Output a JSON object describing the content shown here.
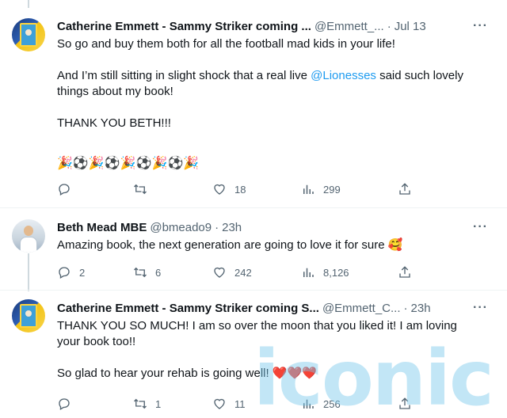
{
  "tweets": [
    {
      "name": "Catherine Emmett - Sammy Striker coming ...",
      "handle": "@Emmett_...",
      "sep": "·",
      "time": "Jul 13",
      "more": "···",
      "text_lines": [
        "So go and buy them both for all the football mad kids in your life!",
        "",
        "And I’m still sitting in slight shock that a real live ",
        "@Lionesses",
        " said such lovely things about my book!",
        "",
        "THANK YOU BETH!!!"
      ],
      "emojis": "🎉⚽🎉⚽🎉⚽🎉⚽🎉",
      "stats": {
        "reply": "",
        "retweet": "",
        "like": "18",
        "views": "299"
      },
      "avatar": "book-cover-avatar"
    },
    {
      "name": "Beth Mead MBE",
      "handle": "@bmeado9",
      "sep": "·",
      "time": "23h",
      "more": "···",
      "text": "Amazing book, the next generation are going to love it for sure 🥰",
      "stats": {
        "reply": "2",
        "retweet": "6",
        "like": "242",
        "views": "8,126"
      },
      "avatar": "player-photo-avatar"
    },
    {
      "name": "Catherine Emmett - Sammy Striker coming S...",
      "handle": "@Emmett_C...",
      "sep": "·",
      "time": "23h",
      "more": "···",
      "text_lines": [
        "THANK YOU SO MUCH! I am so over the moon that you liked it! I am loving your book too!!",
        "So glad to hear your rehab is going well! ❤️❤️❤️"
      ],
      "stats": {
        "reply": "",
        "retweet": "1",
        "like": "11",
        "views": "256"
      },
      "avatar": "book-cover-avatar"
    }
  ],
  "watermark": "iconic",
  "colors": {
    "link": "#1d9bf0",
    "muted": "#536471",
    "text": "#0f1419",
    "divider": "#eff3f4"
  }
}
